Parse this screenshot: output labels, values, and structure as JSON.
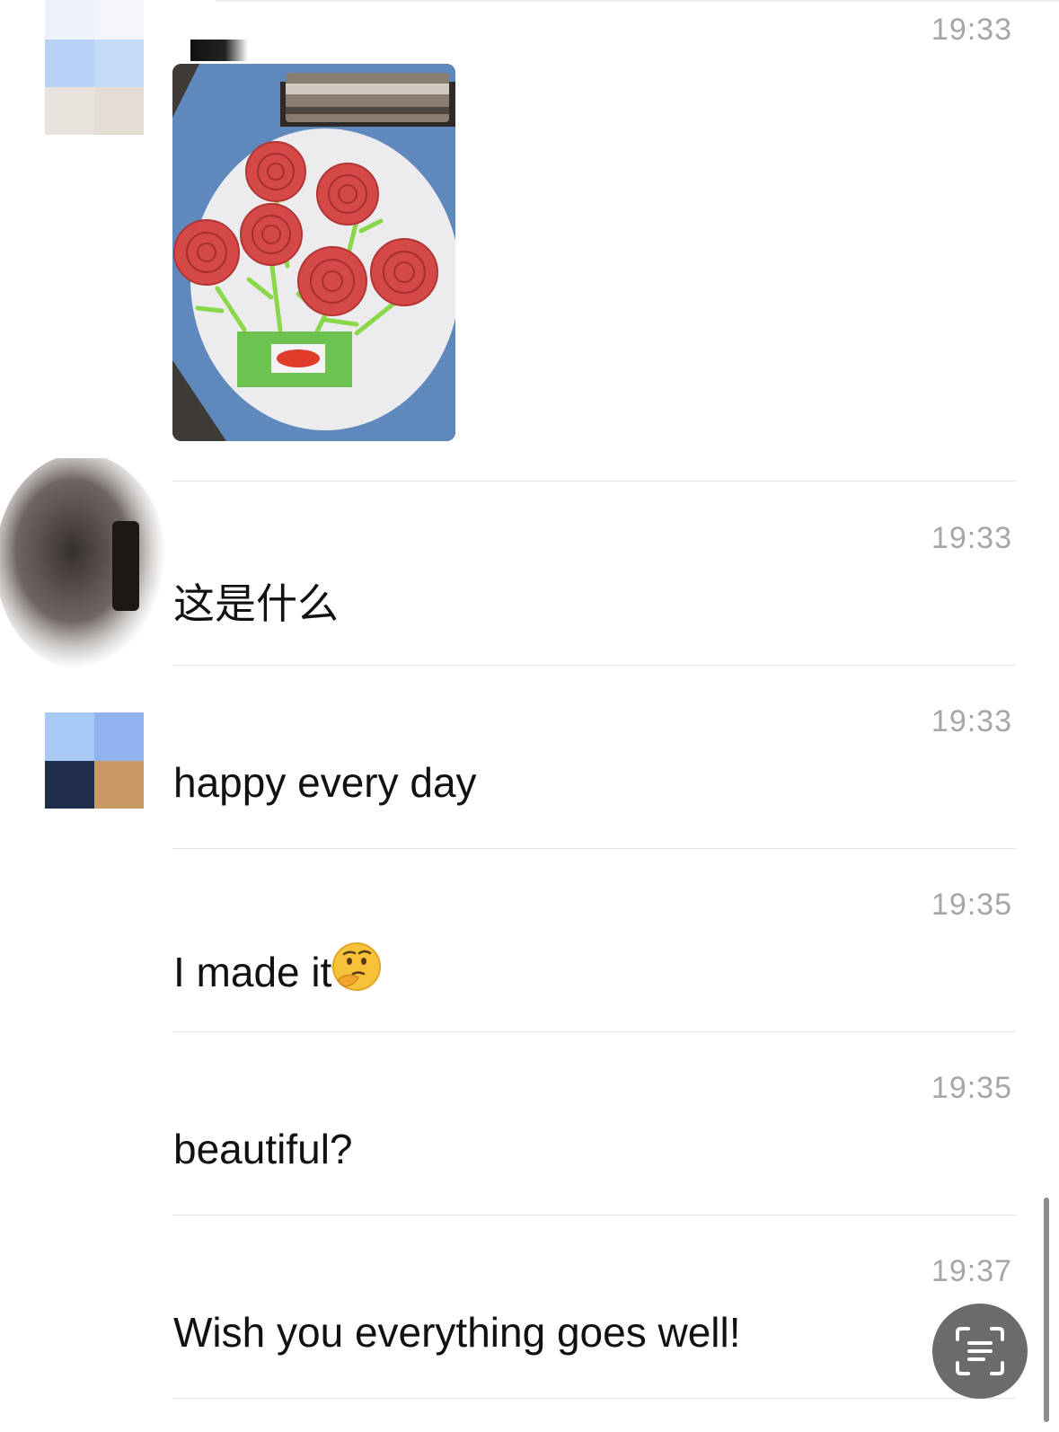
{
  "messages": [
    {
      "time": "19:33",
      "type": "image",
      "avatar_colors": [
        "#f1f5fb",
        "#f3f5fb",
        "#b7d2f6",
        "#c3dcf8",
        "#e8e2dc",
        "#e2dcd4"
      ]
    },
    {
      "time": "19:33",
      "type": "text",
      "text": "这是什么"
    },
    {
      "time": "19:33",
      "type": "text",
      "text": "happy every day",
      "avatar_colors": [
        "#a9c9f5",
        "#8fb4f0",
        "#1f2d4b",
        "#c79a63"
      ]
    },
    {
      "time": "19:35",
      "type": "text",
      "text": "I made it",
      "emoji": "thinking-face"
    },
    {
      "time": "19:35",
      "type": "text",
      "text": "beautiful?"
    },
    {
      "time": "19:37",
      "type": "text",
      "text": "Wish you everything goes well!"
    }
  ],
  "ui": {
    "scan_button_icon": "scan-text-icon",
    "accent_gray": "#a6a6a6"
  }
}
